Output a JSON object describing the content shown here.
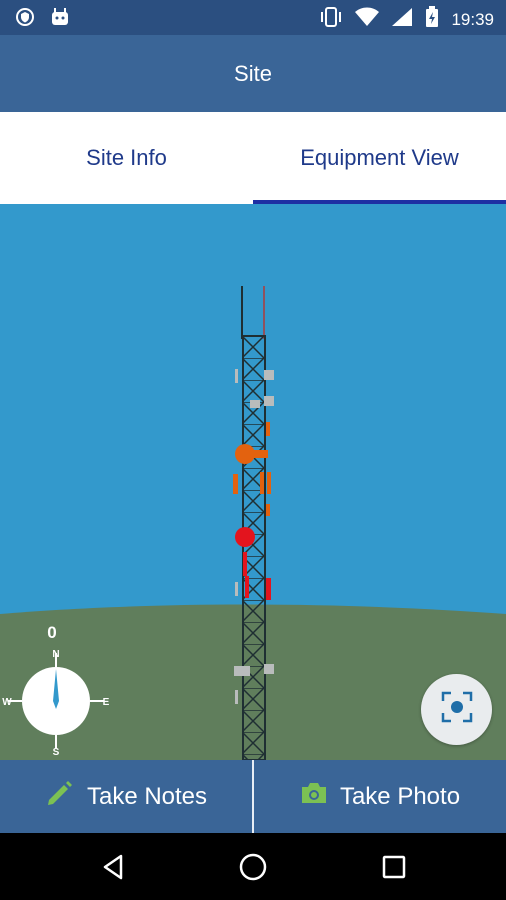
{
  "status_bar": {
    "time": "19:39",
    "left_icons": [
      "shield-icon",
      "android-icon"
    ],
    "right_icons": [
      "vibrate-icon",
      "wifi-icon",
      "signal-icon",
      "battery-icon"
    ]
  },
  "app_bar": {
    "title": "Site"
  },
  "tabs": [
    {
      "label": "Site Info",
      "active": false
    },
    {
      "label": "Equipment View",
      "active": true
    }
  ],
  "scene": {
    "heading": "0",
    "compass": {
      "north": "N",
      "south": "S",
      "east": "E",
      "west": "W"
    },
    "colors": {
      "sky": "#3399cc",
      "ground": "#607e5c",
      "tower": "#1f2f33",
      "orange": "#e3620f",
      "red": "#e3141e",
      "gray": "#b9bcbc"
    }
  },
  "bottom_bar": {
    "notes_label": "Take Notes",
    "photo_label": "Take Photo",
    "notes_icon": "pencil-icon",
    "photo_icon": "camera-icon"
  },
  "nav_bar": {
    "buttons": [
      "back-icon",
      "home-icon",
      "recents-icon"
    ]
  },
  "colors": {
    "primary": "#3a6597",
    "status": "#2b4f80",
    "accent": "#1e2fa3",
    "icon_green": "#7cc153"
  }
}
